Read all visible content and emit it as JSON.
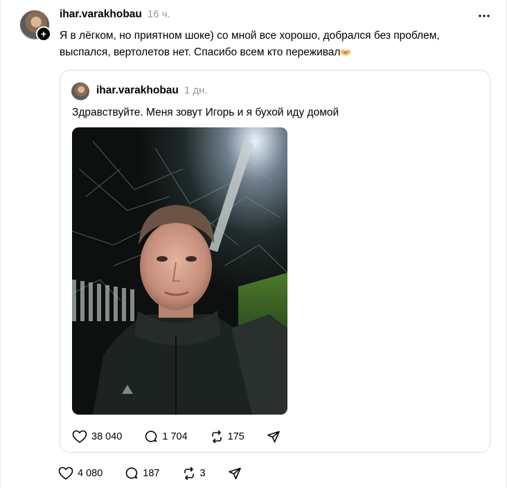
{
  "post": {
    "username": "ihar.varakhobau",
    "time": "16 ч.",
    "text": "Я в лёгком, но приятном шоке) со мной все хорошо, добрался без проблем, выспался, вертолетов нет. Спасибо всем кто переживал",
    "emoji": "heart-hands-emoji",
    "stats": {
      "likes": "4 080",
      "replies": "187",
      "reposts": "3"
    }
  },
  "quoted": {
    "username": "ihar.varakhobau",
    "time": "1 дн.",
    "text": "Здравствуйте. Меня зовут Игорь и я бухой иду домой",
    "photo": "night-selfie-photo",
    "stats": {
      "likes": "38 040",
      "replies": "1 704",
      "reposts": "175"
    }
  },
  "icons": {
    "like": "heart-icon",
    "reply": "comment-bubble-icon",
    "repost": "repost-icon",
    "share": "paper-plane-icon",
    "more": "more-dots-icon",
    "follow": "plus-icon"
  },
  "colors": {
    "muted": "#999999",
    "border": "#dcdcdc",
    "emoji": "#f3c24a"
  }
}
